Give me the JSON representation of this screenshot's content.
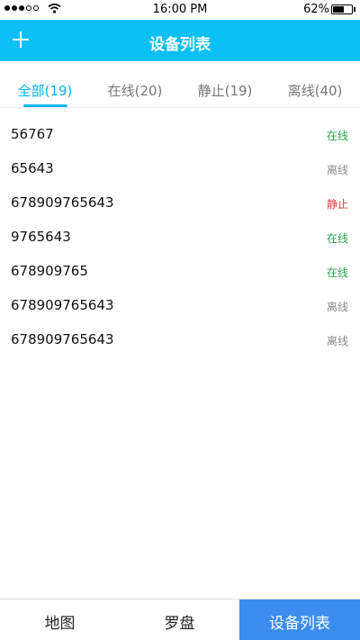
{
  "status_bar": {
    "time": "16:00  PM",
    "battery": "62%",
    "battery_level": 0.62
  },
  "header": {
    "title": "设备列表",
    "add_icon": "plus-icon"
  },
  "tabs": [
    {
      "label": "全部(19)",
      "active": true
    },
    {
      "label": "在线(20)",
      "active": false
    },
    {
      "label": "静止(19)",
      "active": false
    },
    {
      "label": "离线(40)",
      "active": false
    }
  ],
  "devices": [
    {
      "id": "56767",
      "status": "在线"
    },
    {
      "id": "65643",
      "status": "离线"
    },
    {
      "id": "678909765643",
      "status": "静止"
    },
    {
      "id": "9765643",
      "status": "在线"
    },
    {
      "id": "678909765",
      "status": "在线"
    },
    {
      "id": "678909765643",
      "status": "离线"
    },
    {
      "id": "678909765643",
      "status": "离线"
    }
  ],
  "bottom_nav": [
    {
      "label": "地图",
      "active": false
    },
    {
      "label": "罗盘",
      "active": false
    },
    {
      "label": "设备列表",
      "active": true
    }
  ],
  "colors": {
    "header": "#0ac0f5",
    "tab_active": "#0ab4ec",
    "online": "#2aa14a",
    "offline": "#8a8a8a",
    "static": "#e53935",
    "nav_active": "#3b8df0"
  }
}
